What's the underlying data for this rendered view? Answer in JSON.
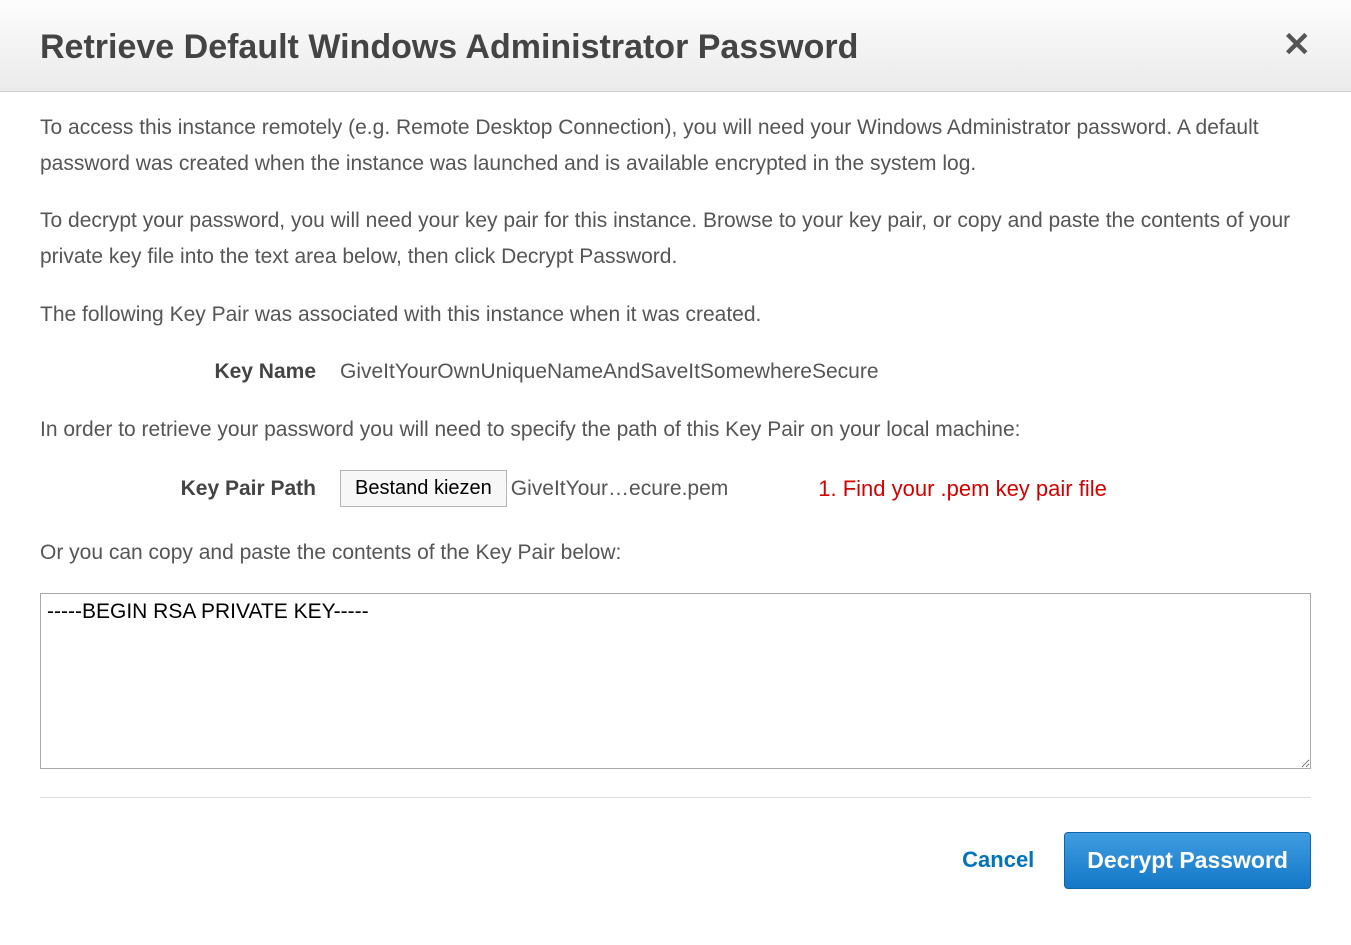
{
  "header": {
    "title": "Retrieve Default Windows Administrator Password"
  },
  "body": {
    "intro1": "To access this instance remotely (e.g. Remote Desktop Connection), you will need your Windows Administrator password. A default password was created when the instance was launched and is available encrypted in the system log.",
    "intro2": "To decrypt your password, you will need your key pair for this instance. Browse to your key pair, or copy and paste the contents of your private key file into the text area below, then click Decrypt Password.",
    "assoc_line": "The following Key Pair was associated with this instance when it was created.",
    "key_name_label": "Key Name",
    "key_name_value": "GiveItYourOwnUniqueNameAndSaveItSomewhereSecure",
    "path_instruction": "In order to retrieve your password you will need to specify the path of this Key Pair on your local machine:",
    "key_pair_path_label": "Key Pair Path",
    "file_button_label": "Bestand kiezen",
    "file_selected_name": "GiveItYour…ecure.pem",
    "annotation_text": "1. Find your .pem key pair file",
    "paste_label": "Or you can copy and paste the contents of the Key Pair below:",
    "textarea_value": "-----BEGIN RSA PRIVATE KEY-----"
  },
  "footer": {
    "cancel_label": "Cancel",
    "decrypt_label": "Decrypt Password"
  }
}
